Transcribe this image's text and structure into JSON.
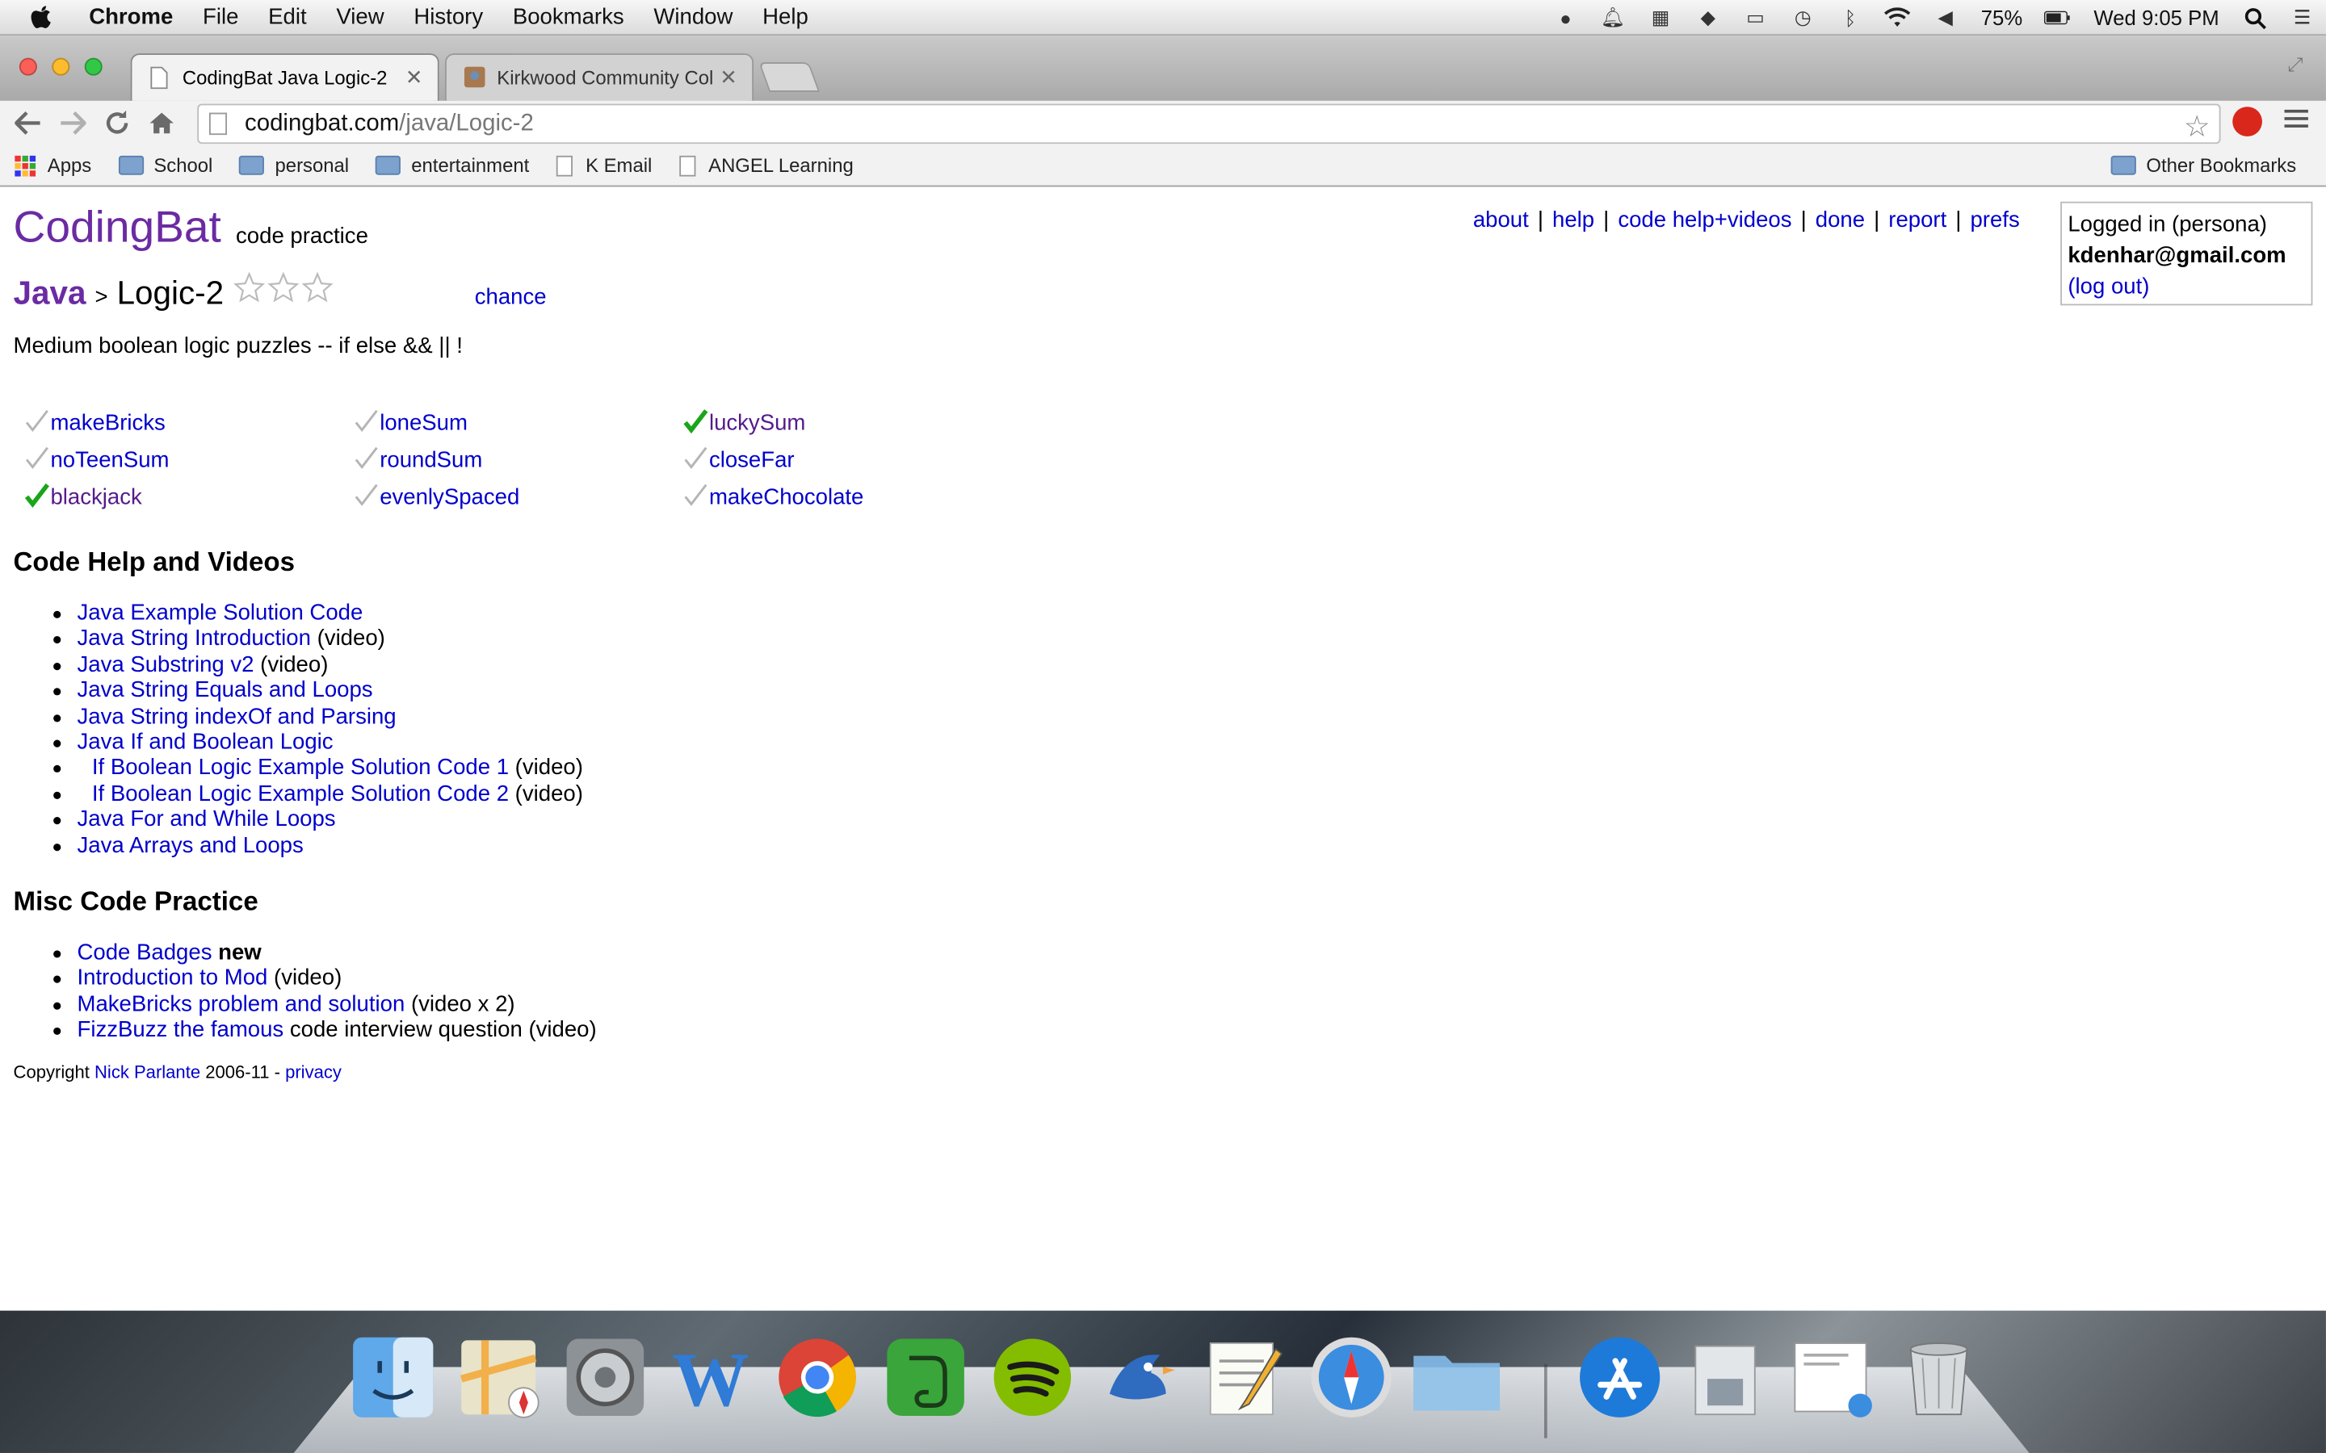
{
  "menubar": {
    "app": "Chrome",
    "items": [
      "File",
      "Edit",
      "View",
      "History",
      "Bookmarks",
      "Window",
      "Help"
    ],
    "battery": "75%",
    "clock": "Wed 9:05 PM"
  },
  "tabs": [
    {
      "title": "CodingBat Java Logic-2"
    },
    {
      "title": "Kirkwood Community Colle"
    }
  ],
  "address": {
    "host": "codingbat.com",
    "path": "/java/Logic-2"
  },
  "bookmarks": [
    "Apps",
    "School",
    "personal",
    "entertainment",
    "K Email",
    "ANGEL Learning"
  ],
  "other_bookmarks": "Other Bookmarks",
  "site": {
    "logo": "CodingBat",
    "logo_sub": "code practice",
    "nav": [
      "about",
      "help",
      "code help+videos",
      "done",
      "report",
      "prefs"
    ],
    "login": {
      "status": "Logged in (persona)",
      "email": "kdenhar@gmail.com",
      "logout": "(log out)"
    }
  },
  "breadcrumb": {
    "lang": "Java",
    "sep": ">",
    "section": "Logic-2",
    "chance": "chance"
  },
  "description": "Medium boolean logic puzzles -- if else && || !",
  "problems": [
    {
      "name": "makeBricks",
      "done": false
    },
    {
      "name": "loneSum",
      "done": false
    },
    {
      "name": "luckySum",
      "done": true
    },
    {
      "name": "noTeenSum",
      "done": false
    },
    {
      "name": "roundSum",
      "done": false
    },
    {
      "name": "closeFar",
      "done": false
    },
    {
      "name": "blackjack",
      "done": true
    },
    {
      "name": "evenlySpaced",
      "done": false
    },
    {
      "name": "makeChocolate",
      "done": false
    }
  ],
  "code_help": {
    "heading": "Code Help and Videos",
    "items": [
      {
        "link": "Java Example Solution Code",
        "suffix": ""
      },
      {
        "link": "Java String Introduction",
        "suffix": " (video)"
      },
      {
        "link": "Java Substring v2",
        "suffix": " (video)"
      },
      {
        "link": "Java String Equals and Loops",
        "suffix": ""
      },
      {
        "link": "Java String indexOf and Parsing",
        "suffix": ""
      },
      {
        "link": "Java If and Boolean Logic",
        "suffix": ""
      },
      {
        "link": "If Boolean Logic Example Solution Code 1",
        "suffix": " (video)"
      },
      {
        "link": "If Boolean Logic Example Solution Code 2",
        "suffix": " (video)"
      },
      {
        "link": "Java For and While Loops",
        "suffix": ""
      },
      {
        "link": "Java Arrays and Loops",
        "suffix": ""
      }
    ]
  },
  "misc": {
    "heading": "Misc Code Practice",
    "items": [
      {
        "link": "Code Badges",
        "suffix": "",
        "bold": "new"
      },
      {
        "link": "Introduction to Mod",
        "suffix": " (video)",
        "bold": ""
      },
      {
        "link": "MakeBricks problem and solution",
        "suffix": " (video x 2)",
        "bold": ""
      },
      {
        "link": "FizzBuzz the famous",
        "suffix": " code interview question (video)",
        "bold": ""
      }
    ]
  },
  "footer": {
    "prefix": "Copyright ",
    "author": "Nick Parlante",
    "years": " 2006-11 - ",
    "privacy": "privacy"
  },
  "dock": [
    "finder-icon",
    "maps-icon",
    "system-preferences-icon",
    "word-icon",
    "chrome-icon",
    "evernote-icon",
    "spotify-icon",
    "cyberduck-icon",
    "textedit-icon",
    "safari-icon",
    "folder-icon",
    "app-store-icon",
    "preview-icon",
    "downloads-icon",
    "trash-icon"
  ],
  "colors": {
    "brand": "#6b2ba3",
    "link": "#0000cc",
    "check_done": "#1aa51a",
    "check_todo": "#b5b5b5"
  }
}
